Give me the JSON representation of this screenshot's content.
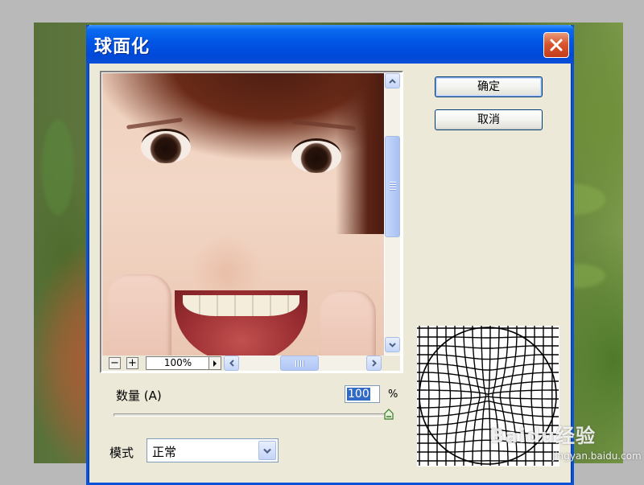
{
  "dialog": {
    "title": "球面化",
    "ok_label": "确定",
    "cancel_label": "取消"
  },
  "preview": {
    "zoom_value": "100%",
    "zoom_out_symbol": "−",
    "zoom_in_symbol": "+"
  },
  "amount": {
    "label": "数量 (A)",
    "value": "100",
    "unit": "%",
    "slider_fraction": 1.0
  },
  "mode": {
    "label": "模式",
    "value": "正常"
  },
  "watermark": {
    "text": "Baidu经验",
    "url": "jingyan.baidu.com"
  },
  "colors": {
    "titlebar": "#0055e5",
    "dialog_bg": "#ece9d8",
    "close_button": "#d8572f",
    "selection": "#316ac5"
  },
  "icons": [
    "close-icon",
    "scroll-up-arrow-icon",
    "scroll-down-arrow-icon",
    "scroll-left-arrow-icon",
    "scroll-right-arrow-icon",
    "dropdown-arrow-icon",
    "slider-thumb-icon"
  ]
}
